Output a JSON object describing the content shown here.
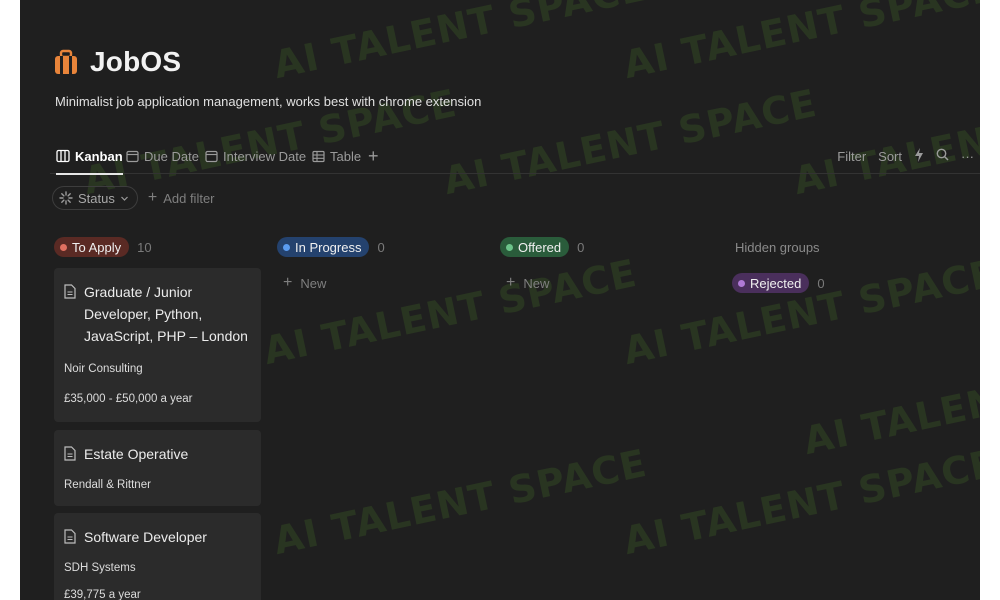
{
  "page": {
    "title": "JobOS",
    "subtitle": "Minimalist job application management, works best with chrome extension"
  },
  "views": {
    "tabs": [
      {
        "label": "Kanban",
        "icon": "board-icon",
        "active": true
      },
      {
        "label": "Due Date",
        "icon": "calendar-icon",
        "active": false
      },
      {
        "label": "Interview Date",
        "icon": "calendar-icon",
        "active": false
      },
      {
        "label": "Table",
        "icon": "table-icon",
        "active": false
      }
    ],
    "add_icon": "plus-icon"
  },
  "toolbar": {
    "filter": "Filter",
    "sort": "Sort",
    "automation_icon": "lightning-icon",
    "search_icon": "search-icon",
    "more": "···"
  },
  "filters": {
    "status_chip": "Status",
    "add_filter": "Add filter"
  },
  "columns": [
    {
      "label": "To Apply",
      "count": "10",
      "color": "#c44a3a",
      "dot": "#e07060",
      "bg": "#5a2a24"
    },
    {
      "label": "In Progress",
      "count": "0",
      "color": "#2d5a9a",
      "dot": "#5b9cf0",
      "bg": "#24426e",
      "new_label": "New"
    },
    {
      "label": "Offered",
      "count": "0",
      "color": "#2f7a4a",
      "dot": "#6cc48a",
      "bg": "#2a5c3b",
      "new_label": "New"
    }
  ],
  "hidden": {
    "label": "Hidden groups",
    "rejected": {
      "label": "Rejected",
      "count": "0",
      "bg": "#4a2f5c",
      "dot": "#b07ad6"
    }
  },
  "cards": [
    {
      "title": "Graduate / Junior Developer, Python, JavaScript, PHP – London",
      "company": "Noir Consulting",
      "salary": "£35,000 - £50,000 a year"
    },
    {
      "title": "Estate Operative",
      "company": "Rendall & Rittner"
    },
    {
      "title": "Software Developer",
      "company": "SDH Systems",
      "salary": "£39,775 a year"
    }
  ],
  "watermark": "AI TALENT SPACE"
}
